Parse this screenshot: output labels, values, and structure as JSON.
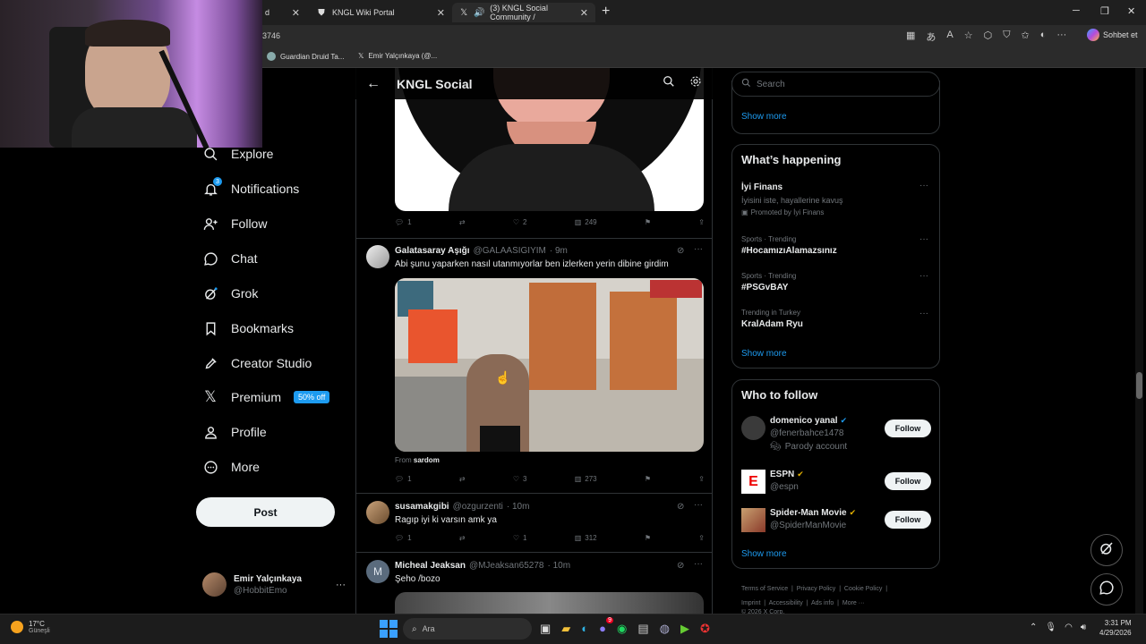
{
  "browser": {
    "tabs": [
      {
        "label": "d",
        "active": false
      },
      {
        "label": "KNGL Wiki Portal",
        "active": false
      },
      {
        "label": "(3) KNGL Social Community /",
        "active": true
      }
    ],
    "address_fragment": "3746",
    "profile_label": "Sohbet et",
    "bookmarks": [
      "Guardian Druid Ta...",
      "Emir Yalçınkaya (@..."
    ]
  },
  "nav": {
    "items": [
      {
        "label": "Explore",
        "icon": "search-icon"
      },
      {
        "label": "Notifications",
        "icon": "bell-icon",
        "badge": "3"
      },
      {
        "label": "Follow",
        "icon": "person-plus-icon"
      },
      {
        "label": "Chat",
        "icon": "chat-icon"
      },
      {
        "label": "Grok",
        "icon": "grok-icon"
      },
      {
        "label": "Bookmarks",
        "icon": "bookmark-icon"
      },
      {
        "label": "Creator Studio",
        "icon": "rocket-icon"
      },
      {
        "label": "Premium",
        "icon": "x-logo-icon",
        "badge": "50% off"
      },
      {
        "label": "Profile",
        "icon": "person-icon"
      },
      {
        "label": "More",
        "icon": "more-circle-icon"
      }
    ],
    "post_label": "Post",
    "account": {
      "name": "Emir Yalçınkaya",
      "handle": "@HobbitEmo"
    }
  },
  "header": {
    "title": "KNGL Social"
  },
  "tweets": [
    {
      "replies": "1",
      "retweets": "",
      "likes": "2",
      "views": "249"
    },
    {
      "name": "Galatasaray Aşığı",
      "handle": "@GALAASIGIYIM",
      "time": "· 9m",
      "text": "Abi şunu yaparken nasıl utanmıyorlar ben izlerken yerin dibine girdim",
      "from_prefix": "From",
      "from_name": "sardom",
      "replies": "1",
      "retweets": "",
      "likes": "3",
      "views": "273"
    },
    {
      "name": "susamakgibi",
      "handle": "@ozgurzenti",
      "time": "· 10m",
      "text": "Ragıp iyi ki varsın amk ya",
      "replies": "1",
      "retweets": "",
      "likes": "1",
      "views": "312"
    },
    {
      "name": "Micheal Jeaksan",
      "handle": "@MJeaksan65278",
      "time": "· 10m",
      "text": "Şeho /bozo",
      "avatar_letter": "M"
    }
  ],
  "right": {
    "search_placeholder": "Search",
    "show_more": "Show more",
    "happening": {
      "title": "What’s happening",
      "promo": {
        "name": "İyi Finans",
        "desc": "İyisini iste, hayallerine kavuş",
        "promoted": "Promoted by İyi Finans"
      },
      "trends": [
        {
          "category": "Sports · Trending",
          "name": "#HocamızıAlamazsınız"
        },
        {
          "category": "Sports · Trending",
          "name": "#PSGvBAY"
        },
        {
          "category": "Trending in Turkey",
          "name": "KralAdam Ryu"
        }
      ]
    },
    "who_to_follow": {
      "title": "Who to follow",
      "follow_label": "Follow",
      "accounts": [
        {
          "name": "domenico yanal",
          "handle": "@fenerbahce1478",
          "note": "Parody account"
        },
        {
          "name": "ESPN",
          "handle": "@espn"
        },
        {
          "name": "Spider-Man Movie",
          "handle": "@SpiderManMovie"
        }
      ]
    },
    "footer": {
      "links": [
        "Terms of Service",
        "Privacy Policy",
        "Cookie Policy",
        "Imprint",
        "Accessibility",
        "Ads info",
        "More ···"
      ],
      "copyright": "© 2026 X Corp."
    }
  },
  "taskbar": {
    "weather": {
      "temp": "17°C",
      "desc": "Güneşli"
    },
    "search_placeholder": "Ara",
    "time": "3:31 PM",
    "date": "4/29/2026",
    "notification_count": "9"
  }
}
